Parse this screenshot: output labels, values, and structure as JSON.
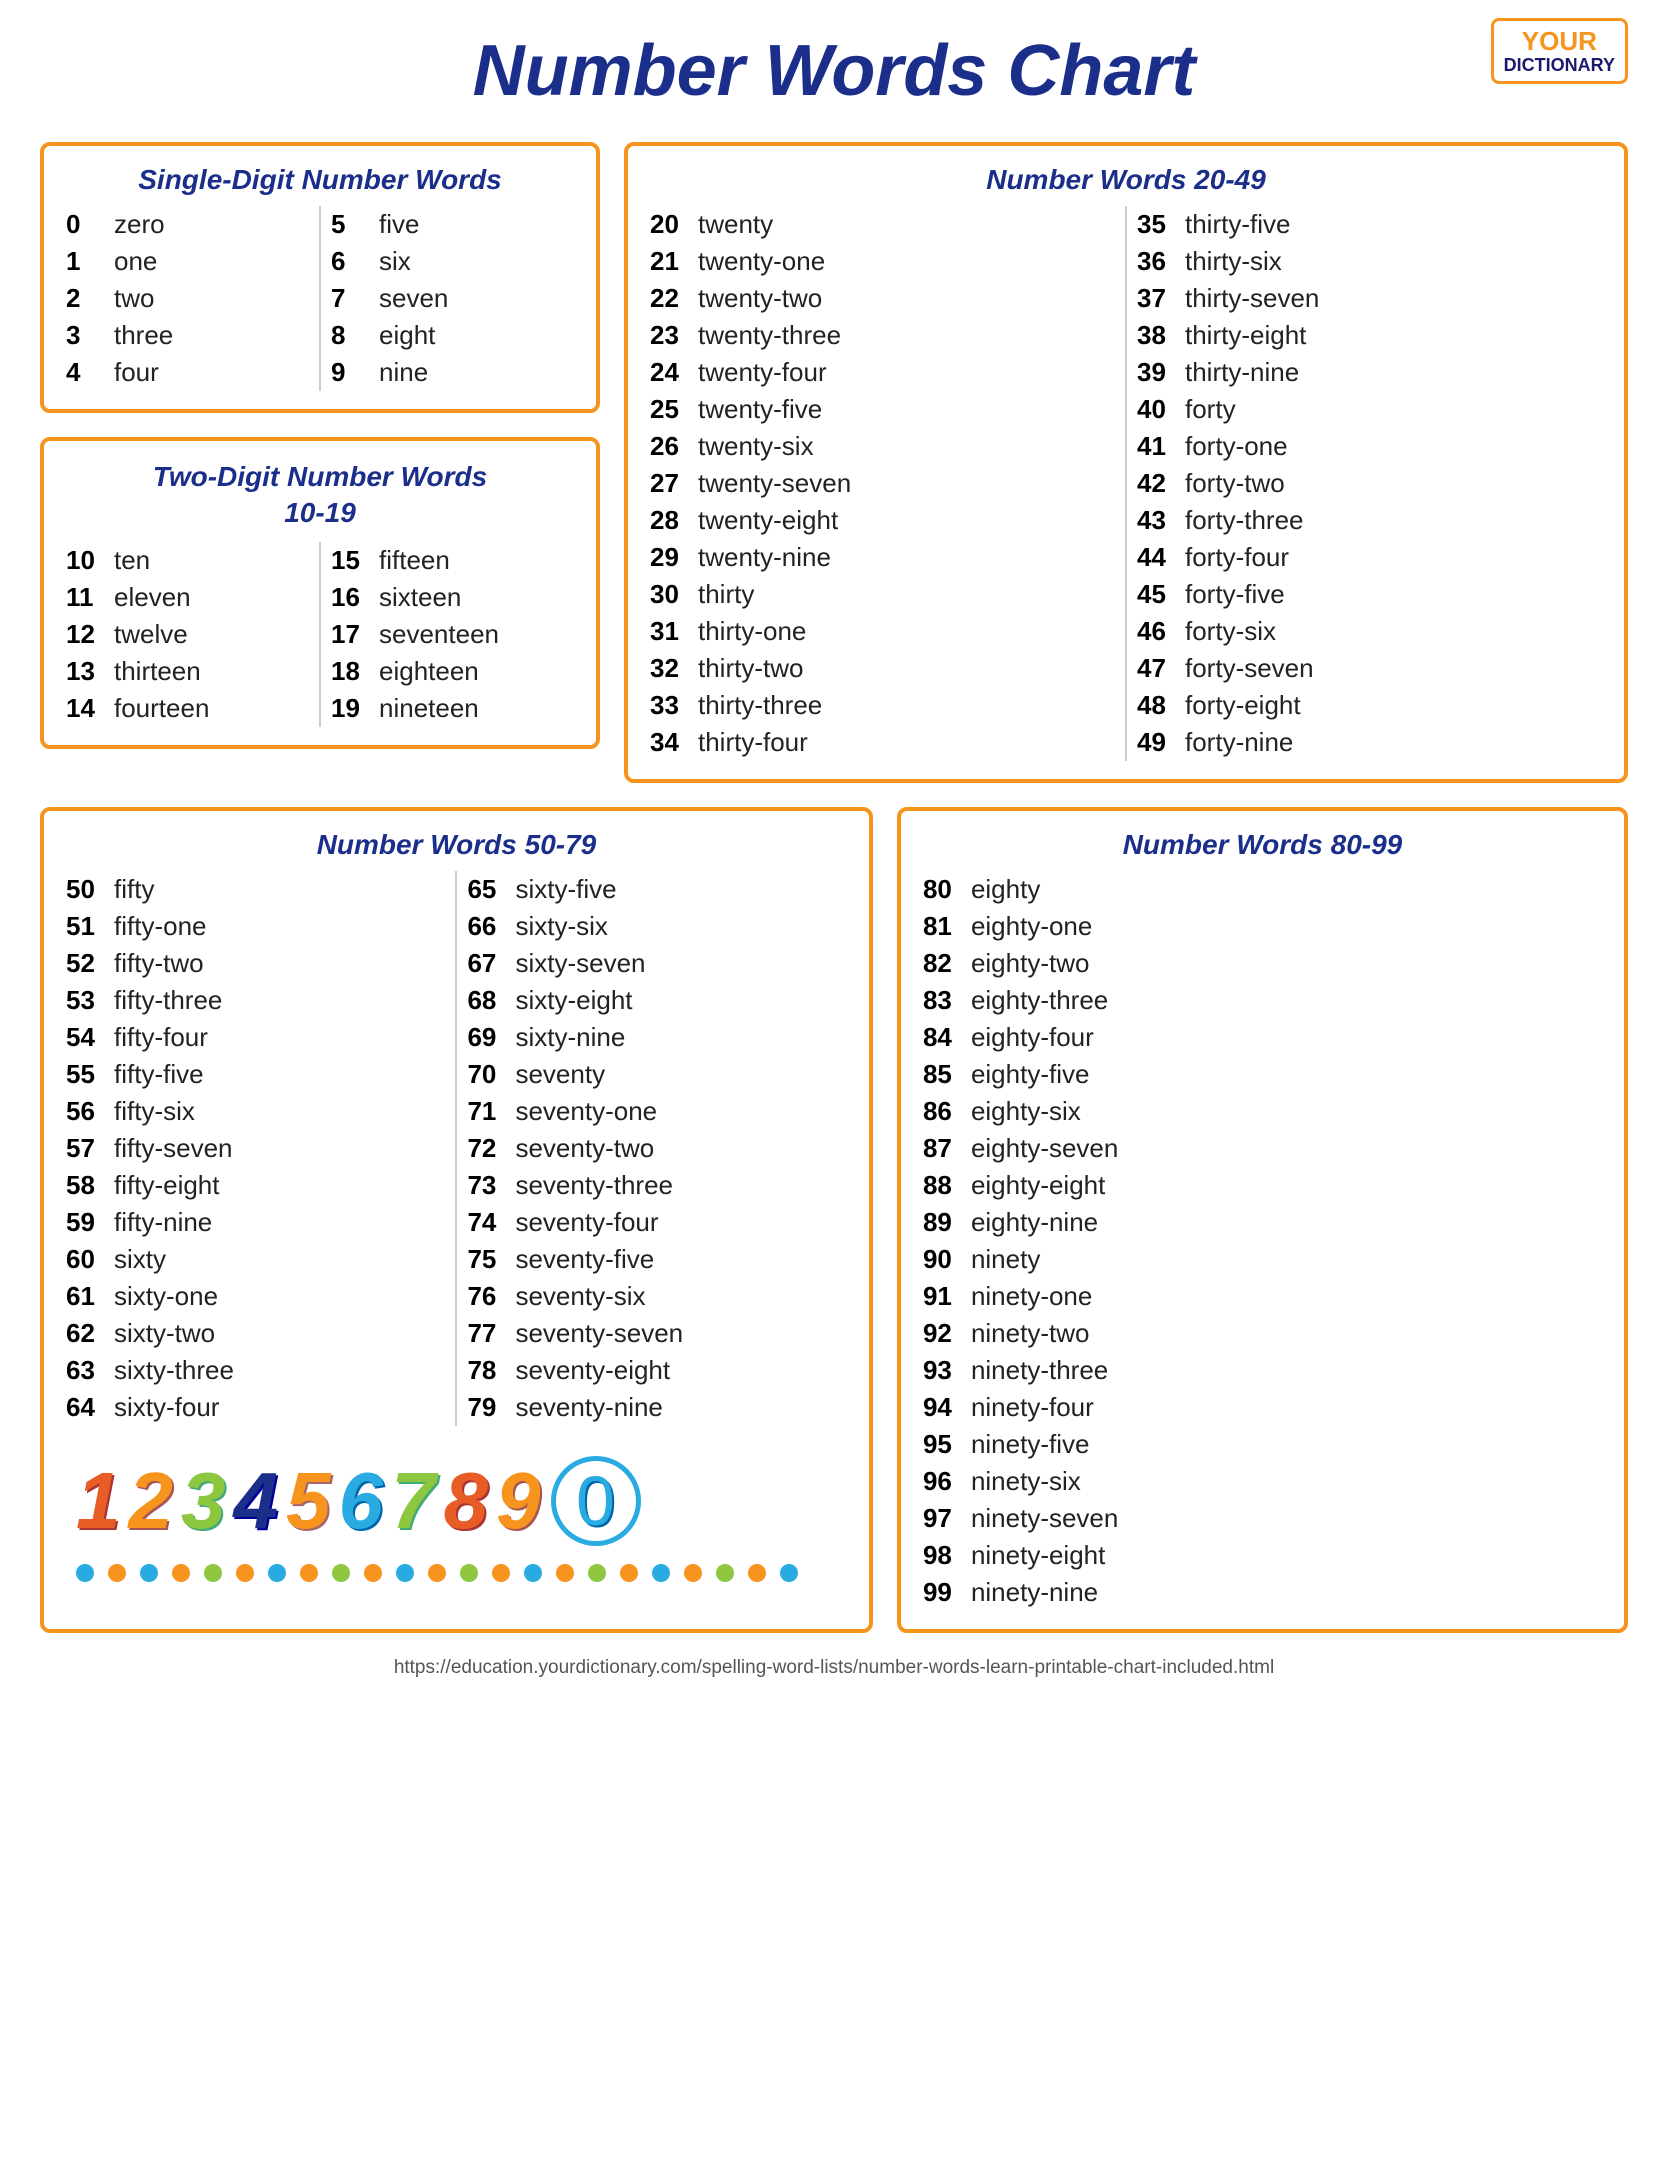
{
  "logo": {
    "your": "YOUR",
    "dot": "·",
    "dictionary": "DICTIONARY"
  },
  "page_title": "Number Words Chart",
  "single_digit": {
    "title": "Single-Digit Number Words",
    "col1": [
      {
        "num": "0",
        "word": "zero"
      },
      {
        "num": "1",
        "word": "one"
      },
      {
        "num": "2",
        "word": "two"
      },
      {
        "num": "3",
        "word": "three"
      },
      {
        "num": "4",
        "word": "four"
      }
    ],
    "col2": [
      {
        "num": "5",
        "word": "five"
      },
      {
        "num": "6",
        "word": "six"
      },
      {
        "num": "7",
        "word": "seven"
      },
      {
        "num": "8",
        "word": "eight"
      },
      {
        "num": "9",
        "word": "nine"
      }
    ]
  },
  "two_digit": {
    "title": "Two-Digit Number Words\n10-19",
    "col1": [
      {
        "num": "10",
        "word": "ten"
      },
      {
        "num": "11",
        "word": "eleven"
      },
      {
        "num": "12",
        "word": "twelve"
      },
      {
        "num": "13",
        "word": "thirteen"
      },
      {
        "num": "14",
        "word": "fourteen"
      }
    ],
    "col2": [
      {
        "num": "15",
        "word": "fifteen"
      },
      {
        "num": "16",
        "word": "sixteen"
      },
      {
        "num": "17",
        "word": "seventeen"
      },
      {
        "num": "18",
        "word": "eighteen"
      },
      {
        "num": "19",
        "word": "nineteen"
      }
    ]
  },
  "words_20_49": {
    "title": "Number Words 20-49",
    "col1": [
      {
        "num": "20",
        "word": "twenty"
      },
      {
        "num": "21",
        "word": "twenty-one"
      },
      {
        "num": "22",
        "word": "twenty-two"
      },
      {
        "num": "23",
        "word": "twenty-three"
      },
      {
        "num": "24",
        "word": "twenty-four"
      },
      {
        "num": "25",
        "word": "twenty-five"
      },
      {
        "num": "26",
        "word": "twenty-six"
      },
      {
        "num": "27",
        "word": "twenty-seven"
      },
      {
        "num": "28",
        "word": "twenty-eight"
      },
      {
        "num": "29",
        "word": "twenty-nine"
      },
      {
        "num": "30",
        "word": "thirty"
      },
      {
        "num": "31",
        "word": "thirty-one"
      },
      {
        "num": "32",
        "word": "thirty-two"
      },
      {
        "num": "33",
        "word": "thirty-three"
      },
      {
        "num": "34",
        "word": "thirty-four"
      }
    ],
    "col2": [
      {
        "num": "35",
        "word": "thirty-five"
      },
      {
        "num": "36",
        "word": "thirty-six"
      },
      {
        "num": "37",
        "word": "thirty-seven"
      },
      {
        "num": "38",
        "word": "thirty-eight"
      },
      {
        "num": "39",
        "word": "thirty-nine"
      },
      {
        "num": "40",
        "word": "forty"
      },
      {
        "num": "41",
        "word": "forty-one"
      },
      {
        "num": "42",
        "word": "forty-two"
      },
      {
        "num": "43",
        "word": "forty-three"
      },
      {
        "num": "44",
        "word": "forty-four"
      },
      {
        "num": "45",
        "word": "forty-five"
      },
      {
        "num": "46",
        "word": "forty-six"
      },
      {
        "num": "47",
        "word": "forty-seven"
      },
      {
        "num": "48",
        "word": "forty-eight"
      },
      {
        "num": "49",
        "word": "forty-nine"
      }
    ]
  },
  "words_50_79": {
    "title": "Number Words 50-79",
    "col1": [
      {
        "num": "50",
        "word": "fifty"
      },
      {
        "num": "51",
        "word": "fifty-one"
      },
      {
        "num": "52",
        "word": "fifty-two"
      },
      {
        "num": "53",
        "word": "fifty-three"
      },
      {
        "num": "54",
        "word": "fifty-four"
      },
      {
        "num": "55",
        "word": "fifty-five"
      },
      {
        "num": "56",
        "word": "fifty-six"
      },
      {
        "num": "57",
        "word": "fifty-seven"
      },
      {
        "num": "58",
        "word": "fifty-eight"
      },
      {
        "num": "59",
        "word": "fifty-nine"
      },
      {
        "num": "60",
        "word": "sixty"
      },
      {
        "num": "61",
        "word": "sixty-one"
      },
      {
        "num": "62",
        "word": "sixty-two"
      },
      {
        "num": "63",
        "word": "sixty-three"
      },
      {
        "num": "64",
        "word": "sixty-four"
      }
    ],
    "col2": [
      {
        "num": "65",
        "word": "sixty-five"
      },
      {
        "num": "66",
        "word": "sixty-six"
      },
      {
        "num": "67",
        "word": "sixty-seven"
      },
      {
        "num": "68",
        "word": "sixty-eight"
      },
      {
        "num": "69",
        "word": "sixty-nine"
      },
      {
        "num": "70",
        "word": "seventy"
      },
      {
        "num": "71",
        "word": "seventy-one"
      },
      {
        "num": "72",
        "word": "seventy-two"
      },
      {
        "num": "73",
        "word": "seventy-three"
      },
      {
        "num": "74",
        "word": "seventy-four"
      },
      {
        "num": "75",
        "word": "seventy-five"
      },
      {
        "num": "76",
        "word": "seventy-six"
      },
      {
        "num": "77",
        "word": "seventy-seven"
      },
      {
        "num": "78",
        "word": "seventy-eight"
      },
      {
        "num": "79",
        "word": "seventy-nine"
      }
    ]
  },
  "words_80_99": {
    "title": "Number Words 80-99",
    "col1": [
      {
        "num": "80",
        "word": "eighty"
      },
      {
        "num": "81",
        "word": "eighty-one"
      },
      {
        "num": "82",
        "word": "eighty-two"
      },
      {
        "num": "83",
        "word": "eighty-three"
      },
      {
        "num": "84",
        "word": "eighty-four"
      },
      {
        "num": "85",
        "word": "eighty-five"
      },
      {
        "num": "86",
        "word": "eighty-six"
      },
      {
        "num": "87",
        "word": "eighty-seven"
      },
      {
        "num": "88",
        "word": "eighty-eight"
      },
      {
        "num": "89",
        "word": "eighty-nine"
      },
      {
        "num": "90",
        "word": "ninety"
      },
      {
        "num": "91",
        "word": "ninety-one"
      },
      {
        "num": "92",
        "word": "ninety-two"
      },
      {
        "num": "93",
        "word": "ninety-three"
      },
      {
        "num": "94",
        "word": "ninety-four"
      },
      {
        "num": "95",
        "word": "ninety-five"
      },
      {
        "num": "96",
        "word": "ninety-six"
      },
      {
        "num": "97",
        "word": "ninety-seven"
      },
      {
        "num": "98",
        "word": "ninety-eight"
      },
      {
        "num": "99",
        "word": "ninety-nine"
      }
    ]
  },
  "footer_url": "https://education.yourdictionary.com/spelling-word-lists/number-words-learn-printable-chart-included.html",
  "deco_numbers": [
    "1",
    "2",
    "3",
    "4",
    "5",
    "6",
    "7",
    "8",
    "9",
    "0"
  ]
}
